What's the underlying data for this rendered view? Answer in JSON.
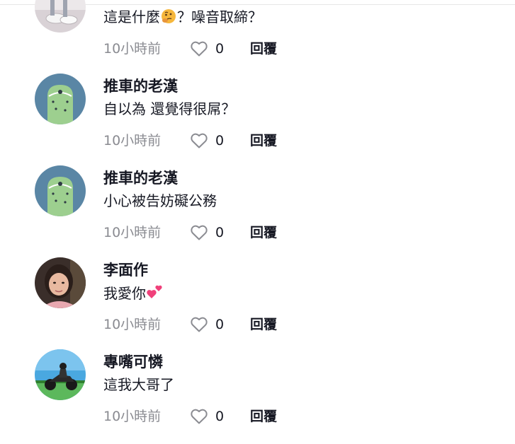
{
  "colors": {
    "text_primary": "#161823",
    "text_secondary": "#8a8b91",
    "heart_outline": "#8a8b91",
    "emoji_heart": "#f0407a"
  },
  "comments": [
    {
      "username": "",
      "text_before_emoji": "這是什麼",
      "emoji": "thinking-face-emoji",
      "text_after_emoji": "？噪音取締？",
      "time": "10小時前",
      "likes": "0",
      "reply_label": "回覆",
      "avatar": "shoes-photo-avatar"
    },
    {
      "username": "推車的老漢",
      "text": "自以為 還覺得很屌？",
      "time": "10小時前",
      "likes": "0",
      "reply_label": "回覆",
      "avatar": "green-creature-avatar"
    },
    {
      "username": "推車的老漢",
      "text": "小心被告妨礙公務",
      "time": "10小時前",
      "likes": "0",
      "reply_label": "回覆",
      "avatar": "green-creature-avatar"
    },
    {
      "username": "李面作",
      "text_before_emoji": "我愛你",
      "emoji": "two-hearts-emoji",
      "time": "10小時前",
      "likes": "0",
      "reply_label": "回覆",
      "avatar": "person-photo-avatar"
    },
    {
      "username": "專嘴可憐",
      "text": "這我大哥了",
      "time": "10小時前",
      "likes": "0",
      "reply_label": "回覆",
      "avatar": "motorcycle-photo-avatar"
    }
  ]
}
